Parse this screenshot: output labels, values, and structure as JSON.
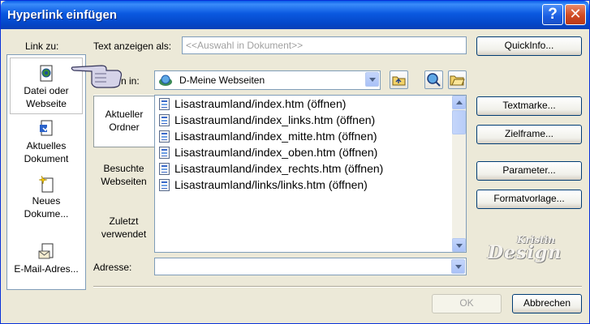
{
  "window": {
    "title": "Hyperlink einfügen"
  },
  "titlebar": {
    "help_label": "?",
    "close_label": "✕"
  },
  "link_to": {
    "label": "Link zu:",
    "items": [
      {
        "label": "Datei oder Webseite",
        "icon": "web-file-icon",
        "selected": true
      },
      {
        "label": "Aktuelles Dokument",
        "icon": "document-icon",
        "selected": false
      },
      {
        "label": "Neues Dokume...",
        "icon": "new-document-icon",
        "selected": false
      },
      {
        "label": "E-Mail-Adres...",
        "icon": "email-icon",
        "selected": false
      }
    ]
  },
  "text_display": {
    "label": "Text anzeigen als:",
    "value": "<<Auswahl in Dokument>>"
  },
  "search_in": {
    "label": "n in:",
    "value": "D-Meine Webseiten"
  },
  "subtabs": [
    {
      "label": "Aktueller Ordner",
      "selected": true
    },
    {
      "label": "Besuchte Webseiten",
      "selected": false
    },
    {
      "label": "Zuletzt verwendet",
      "selected": false
    }
  ],
  "files": [
    "Lisastraumland/index.htm (öffnen)",
    "Lisastraumland/index_links.htm (öffnen)",
    "Lisastraumland/index_mitte.htm (öffnen)",
    "Lisastraumland/index_oben.htm (öffnen)",
    "Lisastraumland/index_rechts.htm (öffnen)",
    "Lisastraumland/links/links.htm (öffnen)"
  ],
  "address": {
    "label": "Adresse:",
    "value": ""
  },
  "buttons": {
    "quickinfo": "QuickInfo...",
    "textmarke": "Textmarke...",
    "zielframe": "Zielframe...",
    "parameter": "Parameter...",
    "formatvorlage": "Formatvorlage...",
    "ok": "OK",
    "cancel": "Abbrechen"
  },
  "watermark": {
    "line1": "Kristin",
    "line2": "Design"
  },
  "colors": {
    "titlebar": "#0b59e0",
    "dialog_bg": "#ece9d8",
    "border": "#7f9db9"
  }
}
